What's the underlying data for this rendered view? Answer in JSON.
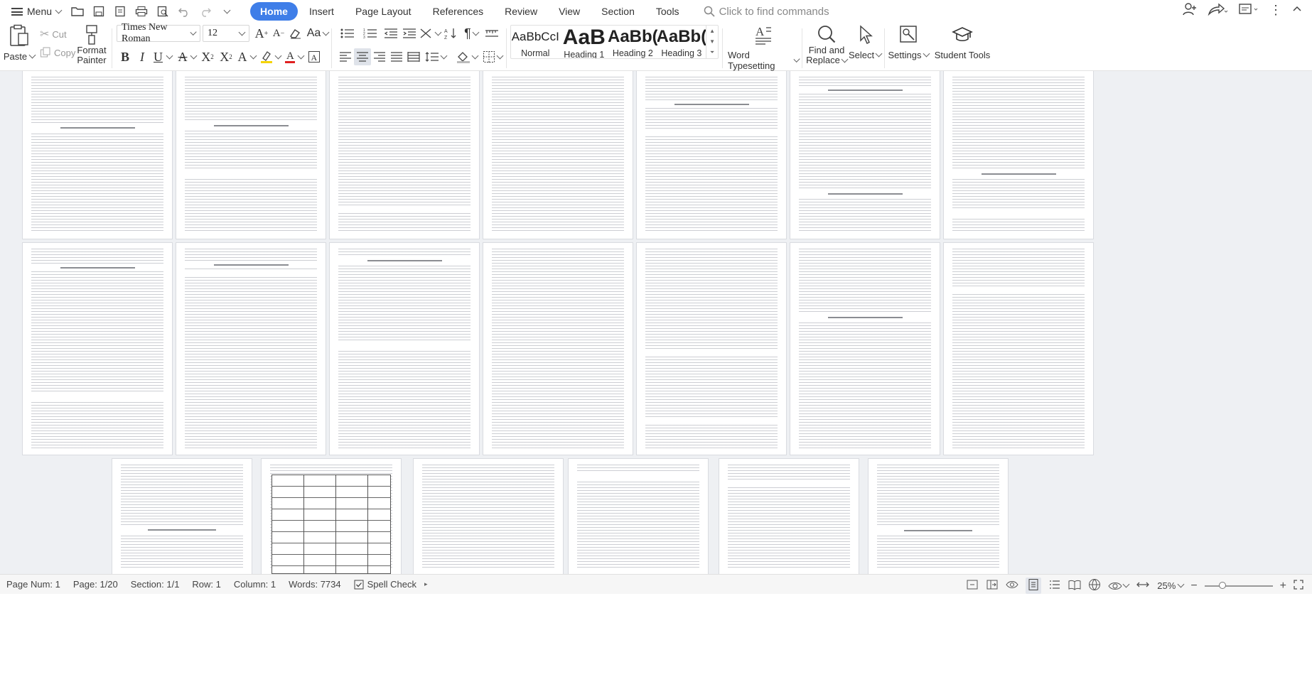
{
  "menubar": {
    "menu_label": "Menu",
    "tabs": [
      {
        "label": "Home",
        "active": true
      },
      {
        "label": "Insert",
        "active": false
      },
      {
        "label": "Page Layout",
        "active": false
      },
      {
        "label": "References",
        "active": false
      },
      {
        "label": "Review",
        "active": false
      },
      {
        "label": "View",
        "active": false
      },
      {
        "label": "Section",
        "active": false
      },
      {
        "label": "Tools",
        "active": false
      }
    ],
    "command_search_placeholder": "Click to find commands",
    "accent": "#3f7ee8"
  },
  "ribbon": {
    "paste_label": "Paste",
    "cut_label": "Cut",
    "copy_label": "Copy",
    "format_painter_label_1": "Format",
    "format_painter_label_2": "Painter",
    "font_name": "Times New Roman",
    "font_size": "12",
    "styles": [
      {
        "sample": "AaBbCcI",
        "label": "Normal"
      },
      {
        "sample": "AaB",
        "label": "Heading 1"
      },
      {
        "sample": "AaBb(",
        "label": "Heading 2"
      },
      {
        "sample": "AaBb(",
        "label": "Heading 3"
      }
    ],
    "word_typesetting_label": "Word Typesetting",
    "find_replace_label_1": "Find and",
    "find_replace_label_2": "Replace",
    "select_label": "Select",
    "settings_label": "Settings",
    "student_tools_label": "Student Tools"
  },
  "statusbar": {
    "page_num": "Page Num: 1",
    "page": "Page: 1/20",
    "section": "Section: 1/1",
    "row": "Row: 1",
    "column": "Column: 1",
    "words": "Words: 7734",
    "spell_check": "Spell Check",
    "zoom": "25%",
    "zoom_level": 0.25
  }
}
